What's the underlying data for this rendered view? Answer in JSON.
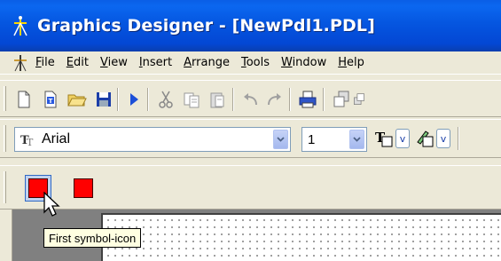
{
  "window": {
    "title": "Graphics Designer - [NewPdl1.PDL]"
  },
  "menubar": {
    "items": [
      {
        "label": "File"
      },
      {
        "label": "Edit"
      },
      {
        "label": "View"
      },
      {
        "label": "Insert"
      },
      {
        "label": "Arrange"
      },
      {
        "label": "Tools"
      },
      {
        "label": "Window"
      },
      {
        "label": "Help"
      }
    ]
  },
  "toolbar_format": {
    "font_name": "Arial",
    "font_size": "1",
    "text_color_label": "v",
    "line_color_label": "v"
  },
  "tooltip": {
    "text": "First symbol-icon"
  },
  "colors": {
    "titlebar": "#0556e0",
    "symbol_fill": "#ff0000",
    "workspace": "#808080",
    "tooltip_bg": "#ffffe1"
  }
}
